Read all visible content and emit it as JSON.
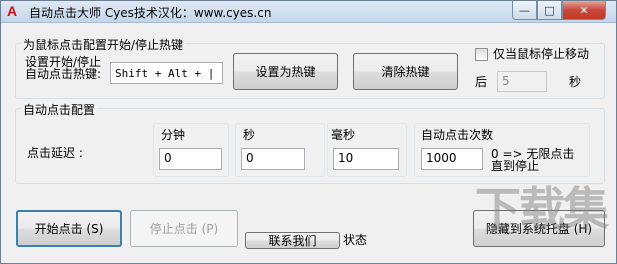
{
  "window": {
    "title": "自动点击大师 Cyes技术汉化：www.cyes.cn",
    "app_icon_glyph": "A",
    "controls": {
      "minimize": "—",
      "maximize": "□",
      "close": "✕"
    }
  },
  "hotkey_group": {
    "title": "为鼠标点击配置开始/停止热键",
    "label_line1": "设置开始/停止",
    "label_line2": "自动点击热键:",
    "hotkey_value": "Shift + Alt + |",
    "set_hotkey_button": "设置为热键",
    "clear_hotkey_button": "清除热键",
    "only_when_stopped_label": "仅当鼠标停止移动",
    "after_label": "后",
    "seconds_value": "5",
    "seconds_unit": "秒"
  },
  "click_config_group": {
    "title": "自动点击配置",
    "delay_label": "点击延迟 :",
    "minutes_label": "分钟",
    "minutes_value": "0",
    "seconds_label": "秒",
    "seconds_value": "0",
    "ms_label": "毫秒",
    "ms_value": "10",
    "count_label": "自动点击次数",
    "count_value": "1000",
    "count_hint_line1": "0 => 无限点击",
    "count_hint_line2": "直到停止"
  },
  "bottom": {
    "start_button": "开始点击 (S)",
    "stop_button": "停止点击 (P)",
    "contact_button": "联系我们",
    "status_label": "状态",
    "tray_button": "隐藏到系统托盘 (H)"
  },
  "watermark": "下载集"
}
